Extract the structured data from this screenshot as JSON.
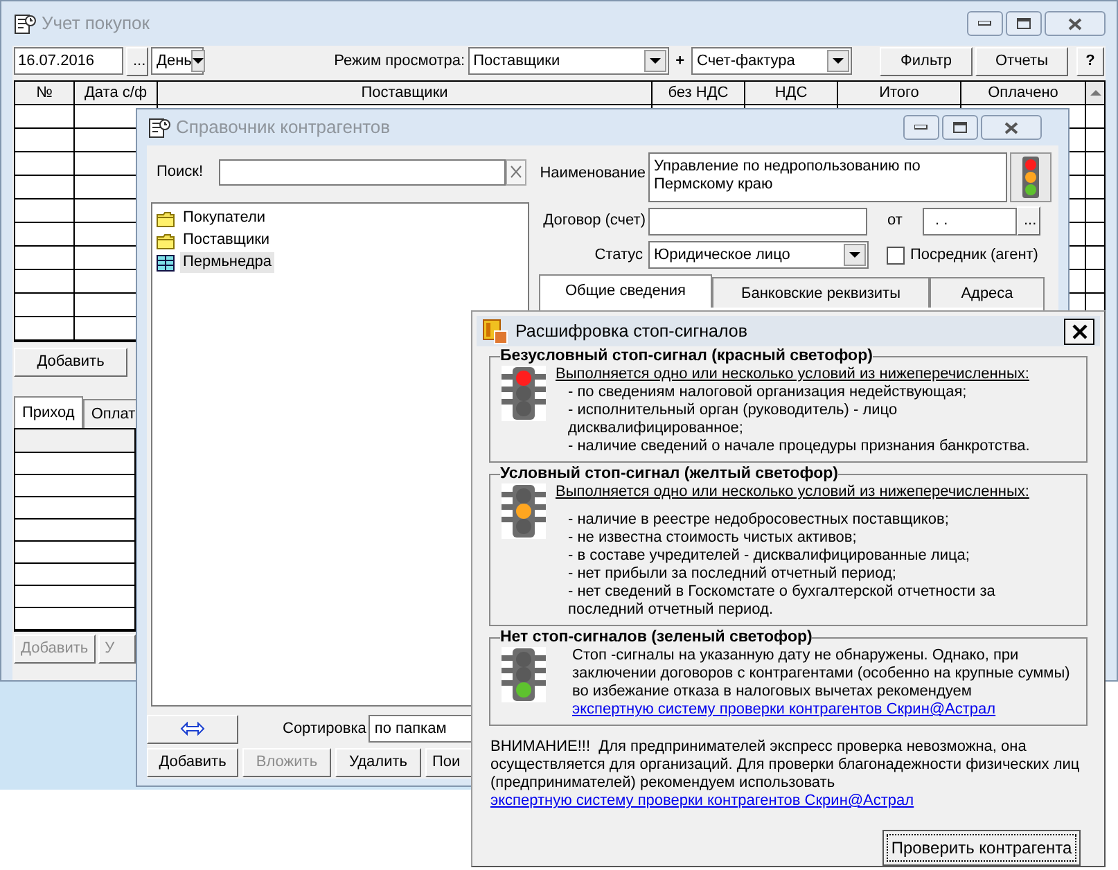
{
  "purchases_window": {
    "title": "Учет покупок",
    "date": "16.07.2016",
    "date_button": "...",
    "period": "День",
    "view_mode_label": "Режим просмотра:",
    "view_mode": "Поставщики",
    "plus": "+",
    "document_type": "Счет-фактура",
    "buttons": [
      "Фильтр",
      "Отчеты"
    ],
    "help": "?",
    "columns": [
      "№",
      "Дата с/ф",
      "Поставщики",
      "без НДС",
      "НДС",
      "Итого",
      "Оплачено"
    ],
    "add_button": "Добавить",
    "tabs": [
      {
        "label": "Приход",
        "selected": true
      },
      {
        "label": "Оплат",
        "selected": false
      }
    ],
    "bottom_buttons": [
      {
        "label": "Добавить",
        "disabled": true
      },
      {
        "label": "У",
        "disabled": true
      }
    ]
  },
  "counterparties_window": {
    "title": "Справочник контрагентов",
    "search_label": "Поиск!",
    "tree": [
      {
        "label": "Покупатели",
        "kind": "folder",
        "selected": false
      },
      {
        "label": "Поставщики",
        "kind": "folder",
        "selected": false
      },
      {
        "label": "Пермьнедра",
        "kind": "record",
        "selected": true
      }
    ],
    "name_label": "Наименование",
    "name_value": "Управление по недропользованию по Пермскому краю",
    "contract_label": "Договор (счет)",
    "from_label": "от",
    "from_value": ". .",
    "from_button": "...",
    "status_label": "Статус",
    "status_value": "Юридическое лицо",
    "agent": {
      "label": "Посредник (агент)",
      "checked": false
    },
    "tabs": [
      {
        "label": "Общие сведения",
        "selected": true
      },
      {
        "label": "Банковские реквизиты",
        "selected": false
      },
      {
        "label": "Адреса",
        "selected": false
      }
    ],
    "sort_label": "Сортировка",
    "sort_value": "по папкам",
    "buttons": [
      {
        "label": "Добавить",
        "disabled": false
      },
      {
        "label": "Вложить",
        "disabled": true
      },
      {
        "label": "Удалить",
        "disabled": false
      },
      {
        "label": "Пои",
        "disabled": false
      }
    ]
  },
  "stop_signals_window": {
    "title": "Расшифровка стоп-сигналов",
    "sections": [
      {
        "kind": "red",
        "heading": "Безусловный стоп-сигнал (красный светофор)",
        "intro": "Выполняется одно или несколько условий из нижеперечисленных:",
        "items": [
          "- по сведениям налоговой организация недействующая;",
          "- исполнительный орган (руководитель) - лицо дисквалифицированное;",
          "- наличие сведений о начале процедуры признания банкротства."
        ]
      },
      {
        "kind": "yellow",
        "heading": "Условный стоп-сигнал (желтый светофор)",
        "intro": "Выполняется одно или несколько условий из нижеперечисленных:",
        "items": [
          "- наличие в реестре недобросовестных поставщиков;",
          "- не известна стоимость чистых активов;",
          "- в составе учредителей - дисквалифицированные лица;",
          "- нет прибыли за последний отчетный период;",
          "- нет сведений в Госкомстате о бухгалтерской отчетности за последний отчетный период."
        ]
      },
      {
        "kind": "green",
        "heading": "Нет стоп-сигналов (зеленый светофор)",
        "text": "Стоп -сигналы на указанную дату не обнаружены. Однако, при заключении договоров с контрагентами (особенно на крупные суммы) во избежание отказа в налоговых вычетах рекомендуем",
        "link": "экспертную систему проверки контрагентов Скрин@Астрал"
      }
    ],
    "warning": {
      "text": "ВНИМАНИЕ!!!  Для предпринимателей экспресс проверка невозможна, она осуществляется для организаций. Для проверки благонадежности физических лиц (предпринимателей) рекомендуем использовать",
      "link": "экспертную систему проверки контрагентов Скрин@Астрал"
    },
    "check_button": "Проверить контрагента"
  }
}
